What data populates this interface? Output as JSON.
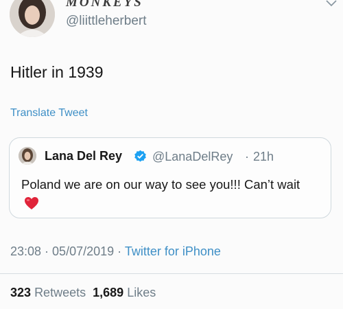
{
  "author": {
    "display_name": "MONKEYS",
    "handle": "@liittleherbert",
    "avatar_icon": "profile-photo"
  },
  "tweet": {
    "text": "Hitler in 1939",
    "translate_label": "Translate Tweet"
  },
  "quoted_tweet": {
    "name": "Lana Del Rey",
    "verified_icon": "verified-badge-icon",
    "handle": "@LanaDelRey",
    "separator": "·",
    "time": "21h",
    "text": "Poland we are on our way to see you!!! Can’t wait",
    "emoji": "red-heart-icon"
  },
  "meta": {
    "time": "23:08",
    "separator_1": " · ",
    "date": "05/07/2019",
    "separator_2": " · ",
    "source": "Twitter for iPhone"
  },
  "stats": {
    "retweets_count": "323",
    "retweets_label": "Retweets",
    "likes_count": "1,689",
    "likes_label": "Likes"
  },
  "colors": {
    "link_blue": "#3e8fc6",
    "muted_gray": "#6e7d88",
    "verified_blue": "#1da1f2",
    "heart_red": "#e0243a"
  }
}
